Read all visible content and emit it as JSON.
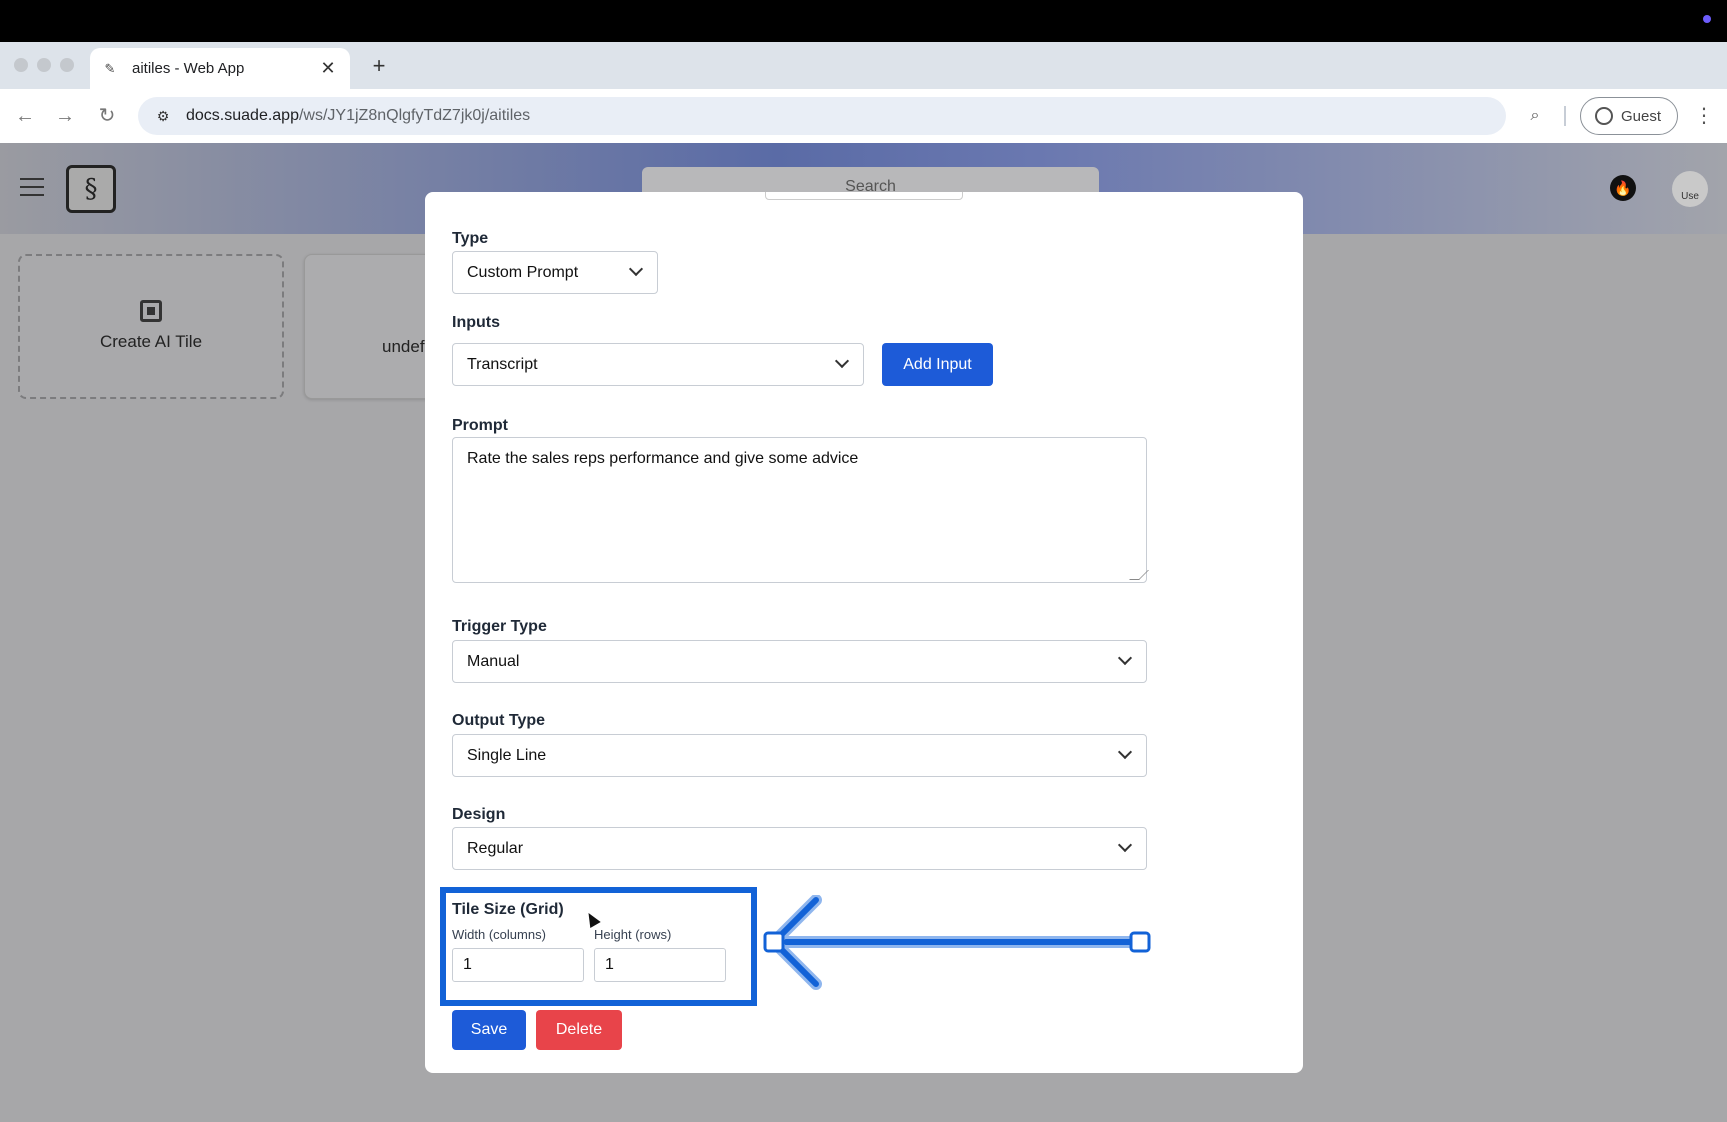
{
  "browser": {
    "tab_title": "aitiles - Web App",
    "new_tab_glyph": "+",
    "close_glyph": "✕",
    "url_host": "docs.suade.app",
    "url_path": "/ws/JY1jZ8nQlgfyTdZ7jk0j/aitiles",
    "profile_label": "Guest"
  },
  "app": {
    "search_placeholder": "Search",
    "avatar_text": "Use"
  },
  "tiles": [
    {
      "label": "Create AI Tile",
      "icon": "chip-icon"
    },
    {
      "label": "undef"
    }
  ],
  "modal": {
    "type": {
      "label": "Type",
      "value": "Custom Prompt"
    },
    "inputs": {
      "label": "Inputs",
      "value": "Transcript",
      "add_button": "Add Input"
    },
    "prompt": {
      "label": "Prompt",
      "value": "Rate the sales reps performance and give some advice"
    },
    "trigger_type": {
      "label": "Trigger Type",
      "value": "Manual"
    },
    "output_type": {
      "label": "Output Type",
      "value": "Single Line"
    },
    "design": {
      "label": "Design",
      "value": "Regular"
    },
    "tile_size": {
      "label": "Tile Size (Grid)",
      "width_label": "Width (columns)",
      "width_value": "1",
      "height_label": "Height (rows)",
      "height_value": "1"
    },
    "save_button": "Save",
    "delete_button": "Delete"
  },
  "colors": {
    "primary": "#1d5bd8",
    "danger": "#e8444a",
    "annotation": "#1262d7"
  }
}
